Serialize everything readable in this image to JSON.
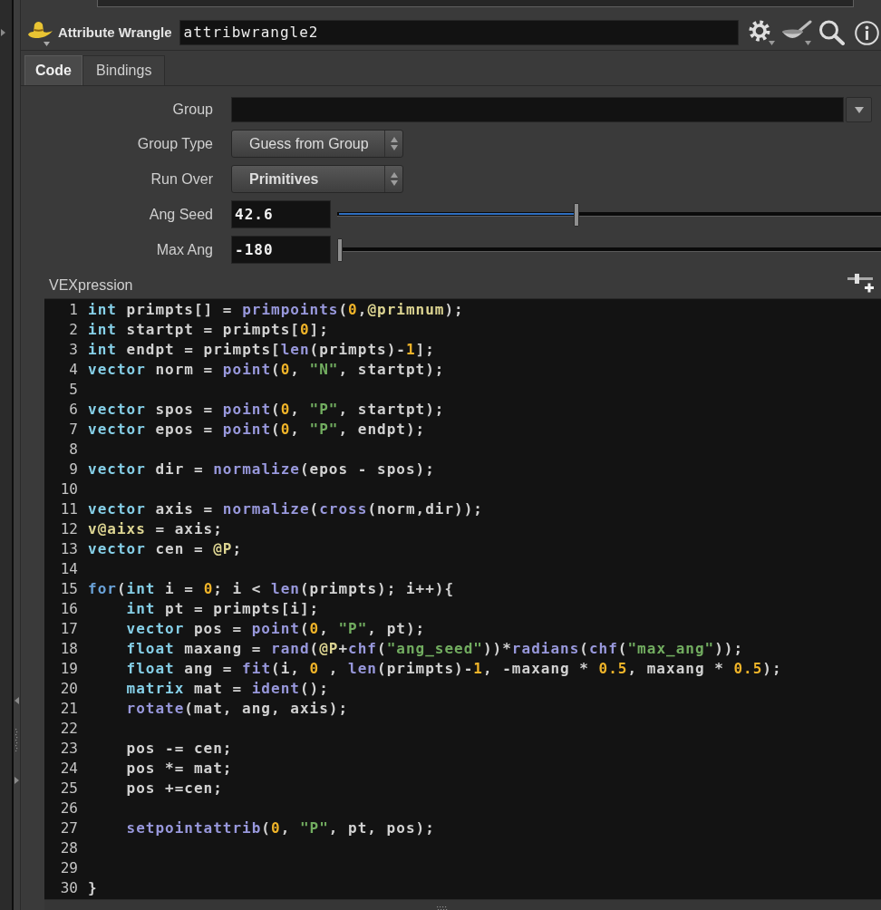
{
  "node": {
    "type": "Attribute Wrangle",
    "name": "attribwrangle2"
  },
  "tabs": [
    {
      "label": "Code",
      "selected": true
    },
    {
      "label": "Bindings",
      "selected": false
    }
  ],
  "parameters": [
    {
      "kind": "text",
      "label": "Group"
    },
    {
      "kind": "menu",
      "label": "Group Type",
      "value": "Guess from Group",
      "changed": false
    },
    {
      "kind": "menu",
      "label": "Run Over",
      "value": "Primitives",
      "changed": true
    },
    {
      "kind": "slider",
      "label": "Ang Seed",
      "value": "42.6",
      "changed": true,
      "level": 0.44
    },
    {
      "kind": "slider",
      "label": "Max Ang",
      "value": "-180",
      "changed": true,
      "level": 0
    }
  ],
  "editor": {
    "label": "VEXpression",
    "lines": [
      {
        "number": "1",
        "tokens": [
          {
            "kind": "keyword",
            "text": "int"
          },
          {
            "kind": "plain",
            "text": " primpts[] = "
          },
          {
            "kind": "function",
            "text": "primpoints"
          },
          {
            "kind": "plain",
            "text": "("
          },
          {
            "kind": "number",
            "text": "0"
          },
          {
            "kind": "plain",
            "text": ","
          },
          {
            "kind": "attribute",
            "text": "@primnum"
          },
          {
            "kind": "plain",
            "text": ");"
          }
        ]
      },
      {
        "number": "2",
        "tokens": [
          {
            "kind": "keyword",
            "text": "int"
          },
          {
            "kind": "plain",
            "text": " startpt = primpts["
          },
          {
            "kind": "number",
            "text": "0"
          },
          {
            "kind": "plain",
            "text": "];"
          }
        ]
      },
      {
        "number": "3",
        "tokens": [
          {
            "kind": "keyword",
            "text": "int"
          },
          {
            "kind": "plain",
            "text": " endpt = primpts["
          },
          {
            "kind": "function",
            "text": "len"
          },
          {
            "kind": "plain",
            "text": "(primpts)-"
          },
          {
            "kind": "number",
            "text": "1"
          },
          {
            "kind": "plain",
            "text": "];"
          }
        ]
      },
      {
        "number": "4",
        "tokens": [
          {
            "kind": "keyword",
            "text": "vector"
          },
          {
            "kind": "plain",
            "text": " norm = "
          },
          {
            "kind": "function",
            "text": "point"
          },
          {
            "kind": "plain",
            "text": "("
          },
          {
            "kind": "number",
            "text": "0"
          },
          {
            "kind": "plain",
            "text": ", "
          },
          {
            "kind": "string",
            "text": "\"N\""
          },
          {
            "kind": "plain",
            "text": ", startpt);"
          }
        ]
      },
      {
        "number": "5"
      },
      {
        "number": "6",
        "tokens": [
          {
            "kind": "keyword",
            "text": "vector"
          },
          {
            "kind": "plain",
            "text": " spos = "
          },
          {
            "kind": "function",
            "text": "point"
          },
          {
            "kind": "plain",
            "text": "("
          },
          {
            "kind": "number",
            "text": "0"
          },
          {
            "kind": "plain",
            "text": ", "
          },
          {
            "kind": "string",
            "text": "\"P\""
          },
          {
            "kind": "plain",
            "text": ", startpt);"
          }
        ]
      },
      {
        "number": "7",
        "tokens": [
          {
            "kind": "keyword",
            "text": "vector"
          },
          {
            "kind": "plain",
            "text": " epos = "
          },
          {
            "kind": "function",
            "text": "point"
          },
          {
            "kind": "plain",
            "text": "("
          },
          {
            "kind": "number",
            "text": "0"
          },
          {
            "kind": "plain",
            "text": ", "
          },
          {
            "kind": "string",
            "text": "\"P\""
          },
          {
            "kind": "plain",
            "text": ", endpt);"
          }
        ]
      },
      {
        "number": "8"
      },
      {
        "number": "9",
        "tokens": [
          {
            "kind": "keyword",
            "text": "vector"
          },
          {
            "kind": "plain",
            "text": " dir = "
          },
          {
            "kind": "function",
            "text": "normalize"
          },
          {
            "kind": "plain",
            "text": "(epos - spos);"
          }
        ]
      },
      {
        "number": "10"
      },
      {
        "number": "11",
        "tokens": [
          {
            "kind": "keyword",
            "text": "vector"
          },
          {
            "kind": "plain",
            "text": " axis = "
          },
          {
            "kind": "function",
            "text": "normalize"
          },
          {
            "kind": "plain",
            "text": "("
          },
          {
            "kind": "function",
            "text": "cross"
          },
          {
            "kind": "plain",
            "text": "(norm,dir));"
          }
        ]
      },
      {
        "number": "12",
        "tokens": [
          {
            "kind": "attribute",
            "text": "v@aixs"
          },
          {
            "kind": "plain",
            "text": " = axis;"
          }
        ]
      },
      {
        "number": "13",
        "tokens": [
          {
            "kind": "keyword",
            "text": "vector"
          },
          {
            "kind": "plain",
            "text": " cen = "
          },
          {
            "kind": "attribute",
            "text": "@P"
          },
          {
            "kind": "plain",
            "text": ";"
          }
        ]
      },
      {
        "number": "14"
      },
      {
        "number": "15",
        "tokens": [
          {
            "kind": "control",
            "text": "for"
          },
          {
            "kind": "plain",
            "text": "("
          },
          {
            "kind": "keyword",
            "text": "int"
          },
          {
            "kind": "plain",
            "text": " i = "
          },
          {
            "kind": "number",
            "text": "0"
          },
          {
            "kind": "plain",
            "text": "; i < "
          },
          {
            "kind": "function",
            "text": "len"
          },
          {
            "kind": "plain",
            "text": "(primpts); i++){"
          }
        ],
        "children": [
          {
            "number": "16",
            "tokens": [
              {
                "kind": "keyword",
                "text": "int"
              },
              {
                "kind": "plain",
                "text": " pt = primpts[i];"
              }
            ]
          },
          {
            "number": "17",
            "tokens": [
              {
                "kind": "keyword",
                "text": "vector"
              },
              {
                "kind": "plain",
                "text": " pos = "
              },
              {
                "kind": "function",
                "text": "point"
              },
              {
                "kind": "plain",
                "text": "("
              },
              {
                "kind": "number",
                "text": "0"
              },
              {
                "kind": "plain",
                "text": ", "
              },
              {
                "kind": "string",
                "text": "\"P\""
              },
              {
                "kind": "plain",
                "text": ", pt);"
              }
            ]
          },
          {
            "number": "18",
            "tokens": [
              {
                "kind": "keyword",
                "text": "float"
              },
              {
                "kind": "plain",
                "text": " maxang = "
              },
              {
                "kind": "function",
                "text": "rand"
              },
              {
                "kind": "plain",
                "text": "("
              },
              {
                "kind": "attribute",
                "text": "@P"
              },
              {
                "kind": "plain",
                "text": "+"
              },
              {
                "kind": "function",
                "text": "chf"
              },
              {
                "kind": "plain",
                "text": "("
              },
              {
                "kind": "string",
                "text": "\"ang_seed\""
              },
              {
                "kind": "plain",
                "text": "))*"
              },
              {
                "kind": "function",
                "text": "radians"
              },
              {
                "kind": "plain",
                "text": "("
              },
              {
                "kind": "function",
                "text": "chf"
              },
              {
                "kind": "plain",
                "text": "("
              },
              {
                "kind": "string",
                "text": "\"max_ang\""
              },
              {
                "kind": "plain",
                "text": "));"
              }
            ]
          },
          {
            "number": "19",
            "tokens": [
              {
                "kind": "keyword",
                "text": "float"
              },
              {
                "kind": "plain",
                "text": " ang = "
              },
              {
                "kind": "function",
                "text": "fit"
              },
              {
                "kind": "plain",
                "text": "(i, "
              },
              {
                "kind": "number",
                "text": "0"
              },
              {
                "kind": "plain",
                "text": " , "
              },
              {
                "kind": "function",
                "text": "len"
              },
              {
                "kind": "plain",
                "text": "(primpts)-"
              },
              {
                "kind": "number",
                "text": "1"
              },
              {
                "kind": "plain",
                "text": ", -maxang * "
              },
              {
                "kind": "number",
                "text": "0.5"
              },
              {
                "kind": "plain",
                "text": ", maxang * "
              },
              {
                "kind": "number",
                "text": "0.5"
              },
              {
                "kind": "plain",
                "text": ");"
              }
            ]
          },
          {
            "number": "20",
            "tokens": [
              {
                "kind": "keyword",
                "text": "matrix"
              },
              {
                "kind": "plain",
                "text": " mat = "
              },
              {
                "kind": "function",
                "text": "ident"
              },
              {
                "kind": "plain",
                "text": "();"
              }
            ]
          },
          {
            "number": "21",
            "tokens": [
              {
                "kind": "function",
                "text": "rotate"
              },
              {
                "kind": "plain",
                "text": "(mat, ang, axis);"
              }
            ]
          },
          {
            "number": "22"
          },
          {
            "number": "23",
            "tokens": [
              {
                "kind": "plain",
                "text": "pos -= cen;"
              }
            ]
          },
          {
            "number": "24",
            "tokens": [
              {
                "kind": "plain",
                "text": "pos *= mat;"
              }
            ]
          },
          {
            "number": "25",
            "tokens": [
              {
                "kind": "plain",
                "text": "pos +=cen;"
              }
            ]
          },
          {
            "number": "26"
          },
          {
            "number": "27",
            "tokens": [
              {
                "kind": "function",
                "text": "setpointattrib"
              },
              {
                "kind": "plain",
                "text": "("
              },
              {
                "kind": "number",
                "text": "0"
              },
              {
                "kind": "plain",
                "text": ", "
              },
              {
                "kind": "string",
                "text": "\"P\""
              },
              {
                "kind": "plain",
                "text": ", pt, pos);"
              }
            ]
          },
          {
            "number": "28"
          },
          {
            "number": "29"
          }
        ]
      },
      {
        "number": "30",
        "tokens": [
          {
            "kind": "plain",
            "text": "}"
          }
        ]
      }
    ]
  }
}
